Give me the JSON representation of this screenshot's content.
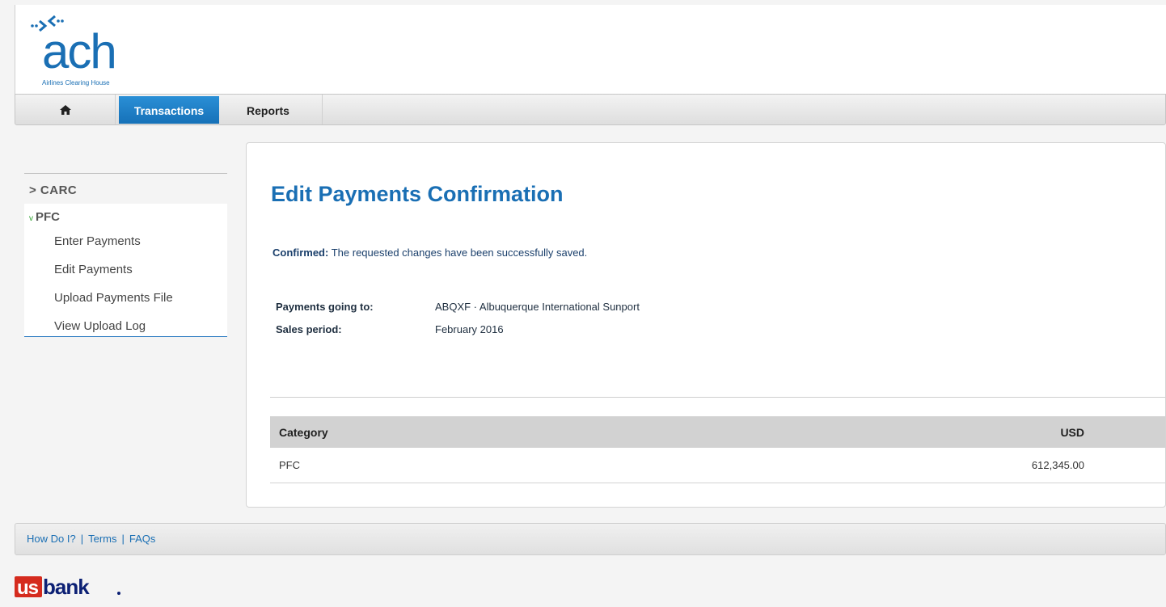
{
  "logo": {
    "word": "ach",
    "tagline": "Airlines Clearing House"
  },
  "nav": {
    "home_icon": "home-icon",
    "transactions": "Transactions",
    "reports": "Reports"
  },
  "sidebar": {
    "carc": "> CARC",
    "pfc_chevron": "v",
    "pfc": "PFC",
    "items": [
      "Enter Payments",
      "Edit Payments",
      "Upload Payments File",
      "View Upload Log"
    ]
  },
  "main": {
    "title": "Edit Payments Confirmation",
    "confirm_label": "Confirmed:",
    "confirm_text": "The requested changes have been successfully saved.",
    "payments_going_to_label": "Payments going to:",
    "payments_going_to_value": "ABQXF  · Albuquerque International Sunport",
    "sales_period_label": "Sales period:",
    "sales_period_value": "February  2016",
    "table": {
      "headers": [
        "Category",
        "USD"
      ],
      "rows": [
        [
          "PFC",
          "612,345.00"
        ]
      ]
    }
  },
  "footer": {
    "links": [
      "How Do I?",
      "Terms",
      "FAQs"
    ],
    "separator": "|"
  },
  "brand": {
    "us": "us",
    "bank": "bank",
    "accent": "#1a6fb4",
    "usbank_red": "#d52b1e",
    "usbank_navy": "#0c2074"
  }
}
